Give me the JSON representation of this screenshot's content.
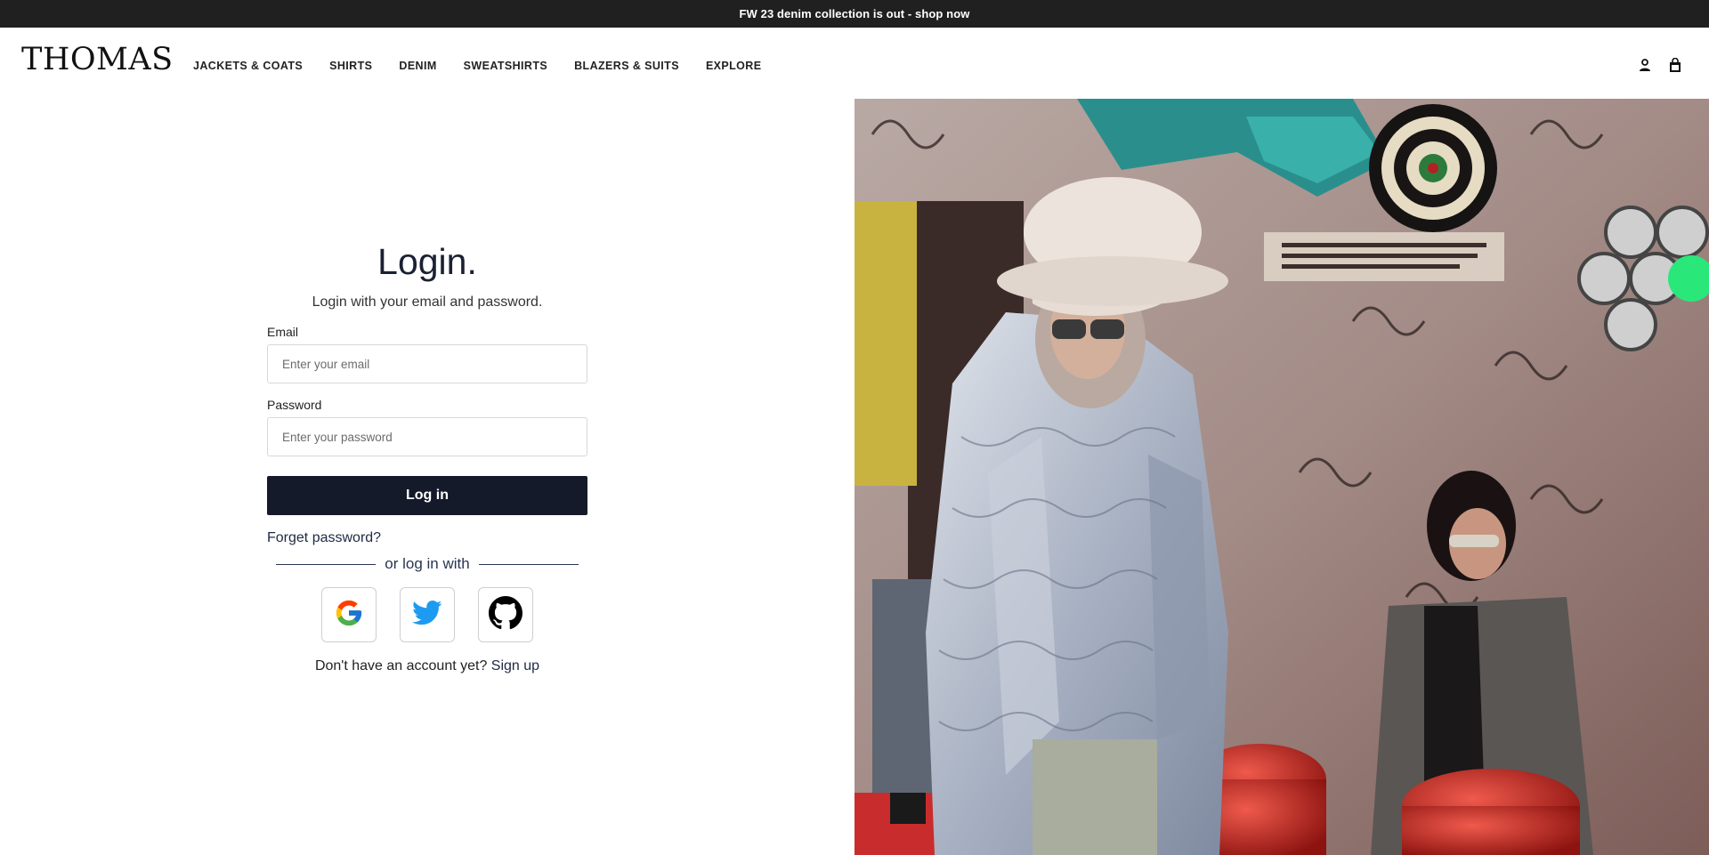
{
  "announcement": {
    "text": "FW 23 denim collection is out - shop now"
  },
  "header": {
    "logo_text": "THOMAS",
    "nav": [
      {
        "label": "JACKETS & COATS"
      },
      {
        "label": "SHIRTS"
      },
      {
        "label": "DENIM"
      },
      {
        "label": "SWEATSHIRTS"
      },
      {
        "label": "BLAZERS & SUITS"
      },
      {
        "label": "EXPLORE"
      }
    ],
    "icons": {
      "account": "user-icon",
      "cart": "shopping-bag-icon"
    }
  },
  "login": {
    "title": "Login.",
    "subtitle": "Login with your email and password.",
    "email_label": "Email",
    "email_placeholder": "Enter your email",
    "password_label": "Password",
    "password_placeholder": "Enter your password",
    "submit_label": "Log in",
    "forgot_label": "Forget password?",
    "divider_text": "or log in with",
    "social": [
      {
        "icon": "google-icon"
      },
      {
        "icon": "twitter-icon"
      },
      {
        "icon": "github-icon"
      }
    ],
    "signup_prompt": "Don't have an account yet?",
    "signup_link": "Sign up"
  },
  "colors": {
    "announcement_bg": "#202020",
    "button_bg": "#141a29",
    "twitter_blue": "#1d9bf0"
  }
}
